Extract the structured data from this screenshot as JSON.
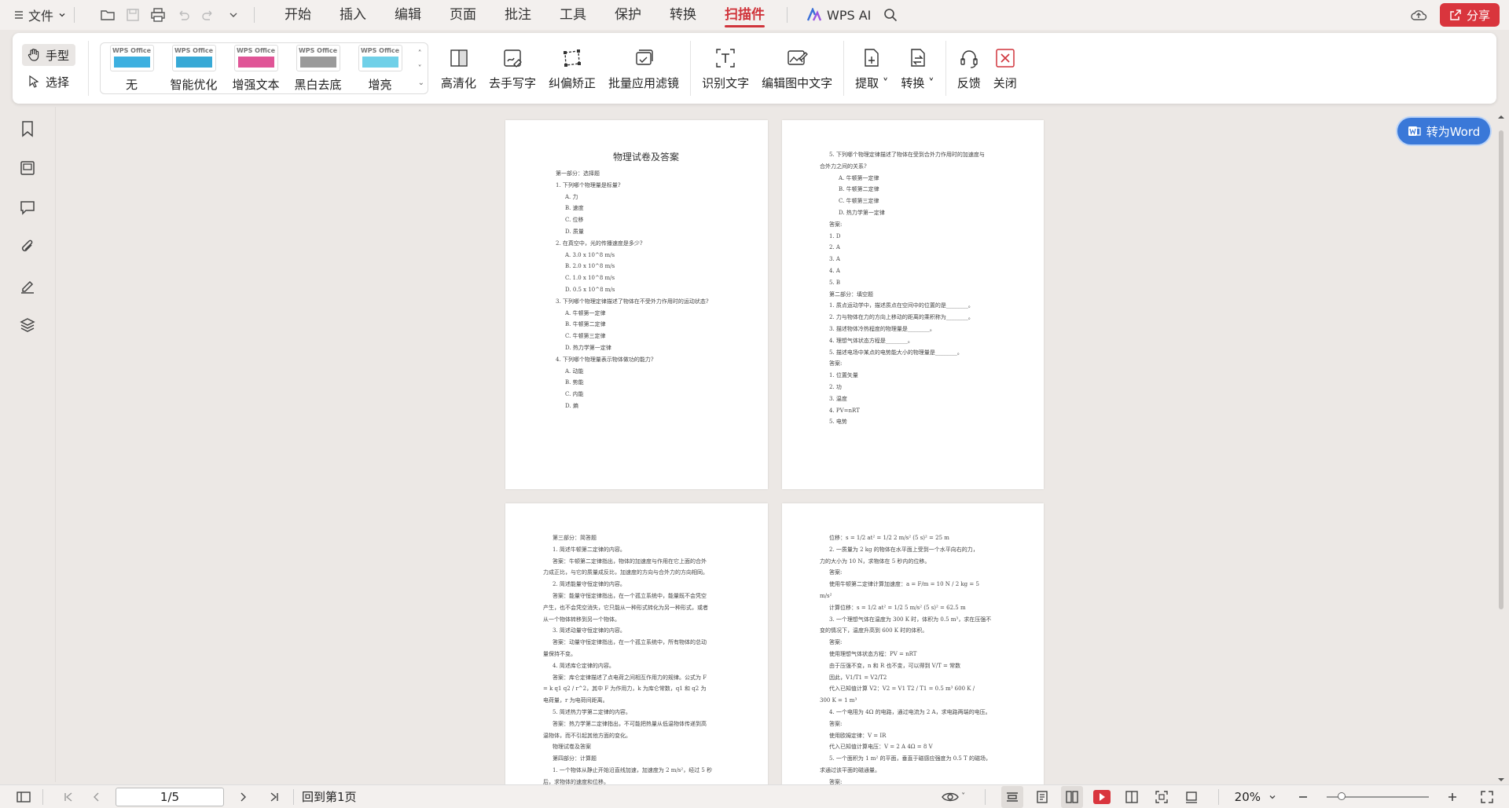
{
  "menubar": {
    "file_label": "文件",
    "tabs": [
      "开始",
      "插入",
      "编辑",
      "页面",
      "批注",
      "工具",
      "保护",
      "转换",
      "扫描件"
    ],
    "active_tab": "扫描件",
    "wps_ai": "WPS AI",
    "share": "分享"
  },
  "ribbon": {
    "modes": [
      {
        "label": "手型",
        "icon": "hand-icon"
      },
      {
        "label": "选择",
        "icon": "cursor-icon"
      }
    ],
    "filters": [
      {
        "label": "无",
        "logo": "WPS Office",
        "color": "#3db0e0"
      },
      {
        "label": "智能优化",
        "logo": "WPS Office",
        "color": "#37a9d6"
      },
      {
        "label": "增强文本",
        "logo": "WPS Office",
        "color": "#e05597"
      },
      {
        "label": "黑白去底",
        "logo": "WPS Office",
        "color": "#9a9a9a"
      },
      {
        "label": "增亮",
        "logo": "WPS Office",
        "color": "#6fd0e8"
      }
    ],
    "tools": [
      "高清化",
      "去手写字",
      "纠偏矫正",
      "批量应用滤镜"
    ],
    "ocr": [
      "识别文字",
      "编辑图中文字"
    ],
    "extract": "提取",
    "convert": "转换",
    "feedback": "反馈",
    "close": "关闭"
  },
  "convert_word": "转为Word",
  "pages": {
    "p1": {
      "title": "物理试卷及答案",
      "lines": [
        {
          "t": "第一部分：选择题",
          "i": 0
        },
        {
          "t": "1. 下列哪个物理量是标量?",
          "i": 0
        },
        {
          "t": "A. 力",
          "i": 1
        },
        {
          "t": "B. 速度",
          "i": 1
        },
        {
          "t": "C. 位移",
          "i": 1
        },
        {
          "t": "D. 质量",
          "i": 1
        },
        {
          "t": "2. 在真空中，光的传播速度是多少?",
          "i": 0
        },
        {
          "t": "A. 3.0 x 10^8 m/s",
          "i": 1
        },
        {
          "t": "B. 2.0 x 10^8 m/s",
          "i": 1
        },
        {
          "t": "C. 1.0 x 10^8 m/s",
          "i": 1
        },
        {
          "t": "D. 0.5 x 10^8 m/s",
          "i": 1
        },
        {
          "t": "3. 下列哪个物理定律描述了物体在不受外力作用时的运动状态?",
          "i": 0
        },
        {
          "t": "A. 牛顿第一定律",
          "i": 1
        },
        {
          "t": "B. 牛顿第二定律",
          "i": 1
        },
        {
          "t": "C. 牛顿第三定律",
          "i": 1
        },
        {
          "t": "D. 热力学第一定律",
          "i": 1
        },
        {
          "t": "4. 下列哪个物理量表示物体做功的能力?",
          "i": 0
        },
        {
          "t": "A. 动能",
          "i": 1
        },
        {
          "t": "B. 势能",
          "i": 1
        },
        {
          "t": "C. 内能",
          "i": 1
        },
        {
          "t": "D. 熵",
          "i": 1
        }
      ]
    },
    "p2": {
      "lines": [
        {
          "t": "5. 下列哪个物理定律描述了物体在受到合外力作用时的加速度与",
          "i": 1
        },
        {
          "t": "合外力之间的关系?",
          "i": 0
        },
        {
          "t": "A. 牛顿第一定律",
          "i": 2
        },
        {
          "t": "B. 牛顿第二定律",
          "i": 2
        },
        {
          "t": "C. 牛顿第三定律",
          "i": 2
        },
        {
          "t": "D. 热力学第一定律",
          "i": 2
        },
        {
          "t": "答案:",
          "i": 1
        },
        {
          "t": "1. D",
          "i": 1
        },
        {
          "t": "2. A",
          "i": 1
        },
        {
          "t": "3. A",
          "i": 1
        },
        {
          "t": "4. A",
          "i": 1
        },
        {
          "t": "5. B",
          "i": 1
        },
        {
          "t": "第二部分：填空题",
          "i": 1
        },
        {
          "t": "1. 质点运动学中，描述质点在空间中的位置的是________。",
          "i": 1
        },
        {
          "t": "2. 力与物体在力的方向上移动的距离的乘积称为________。",
          "i": 1
        },
        {
          "t": "3. 描述物体冷热程度的物理量是________。",
          "i": 1
        },
        {
          "t": "4. 理想气体状态方程是________。",
          "i": 1
        },
        {
          "t": "5. 描述电场中某点的电势能大小的物理量是________。",
          "i": 1
        },
        {
          "t": "答案:",
          "i": 1
        },
        {
          "t": "1. 位置矢量",
          "i": 1
        },
        {
          "t": "2. 功",
          "i": 1
        },
        {
          "t": "3. 温度",
          "i": 1
        },
        {
          "t": "4. PV=nRT",
          "i": 1
        },
        {
          "t": "5. 电势",
          "i": 1
        }
      ]
    },
    "p3": {
      "lines": [
        {
          "t": "第三部分：简答题",
          "i": 1
        },
        {
          "t": "1. 简述牛顿第二定律的内容。",
          "i": 1
        },
        {
          "t": "答案：牛顿第二定律指出，物体的加速度与作用在它上面的合外",
          "i": 1
        },
        {
          "t": "力成正比，与它的质量成反比，加速度的方向与合外力的方向相同。",
          "i": 0
        },
        {
          "t": "2. 简述能量守恒定律的内容。",
          "i": 1
        },
        {
          "t": "答案：能量守恒定律指出，在一个孤立系统中，能量既不会凭空",
          "i": 1
        },
        {
          "t": "产生，也不会凭空消失，它只能从一种形式转化为另一种形式，或者",
          "i": 0
        },
        {
          "t": "从一个物体转移到另一个物体。",
          "i": 0
        },
        {
          "t": "3. 简述动量守恒定律的内容。",
          "i": 1
        },
        {
          "t": "答案：动量守恒定律指出，在一个孤立系统中，所有物体的总动",
          "i": 1
        },
        {
          "t": "量保持不变。",
          "i": 0
        },
        {
          "t": "4. 简述库仑定律的内容。",
          "i": 1
        },
        {
          "t": "答案：库仑定律描述了点电荷之间相互作用力的规律。公式为 F",
          "i": 1
        },
        {
          "t": "= k  q1  q2 / r^2，其中 F 为作用力，k 为库仑常数，q1 和 q2 为",
          "i": 0
        },
        {
          "t": "电荷量，r 为电荷间距离。",
          "i": 0
        },
        {
          "t": "5. 简述热力学第二定律的内容。",
          "i": 1
        },
        {
          "t": "答案：热力学第二定律指出，不可能把热量从低温物体传递到高",
          "i": 1
        },
        {
          "t": "温物体，而不引起其他方面的变化。",
          "i": 0
        },
        {
          "t": "物理试卷及答案",
          "i": 1
        },
        {
          "t": "第四部分：计算题",
          "i": 1
        },
        {
          "t": "1. 一个物体从静止开始沿直线加速，加速度为 2 m/s²，经过 5 秒",
          "i": 1
        },
        {
          "t": "后，求物体的速度和位移。",
          "i": 0
        }
      ]
    },
    "p4": {
      "lines": [
        {
          "t": "位移：s = 1/2  at² = 1/2  2 m/s²  (5 s)² = 25 m",
          "i": 1
        },
        {
          "t": "2. 一质量为 2 kg 的物体在水平面上受到一个水平向右的力，",
          "i": 1
        },
        {
          "t": "力的大小为 10 N，求物体在 5 秒内的位移。",
          "i": 0
        },
        {
          "t": "答案:",
          "i": 1
        },
        {
          "t": "使用牛顿第二定律计算加速度：a = F/m = 10 N / 2 kg = 5",
          "i": 1
        },
        {
          "t": "m/s²",
          "i": 0
        },
        {
          "t": "计算位移：s = 1/2  at² = 1/2  5 m/s²  (5 s)² = 62.5 m",
          "i": 1
        },
        {
          "t": "3. 一个理想气体在温度为 300 K 时，体积为 0.5 m³，求在压强不",
          "i": 1
        },
        {
          "t": "变的情况下，温度升高到 600 K 时的体积。",
          "i": 0
        },
        {
          "t": "答案:",
          "i": 1
        },
        {
          "t": "使用理想气体状态方程：PV = nRT",
          "i": 1
        },
        {
          "t": "由于压强不变，n 和 R 也不变，可以得到 V/T = 常数",
          "i": 1
        },
        {
          "t": "因此，V1/T1 = V2/T2",
          "i": 1
        },
        {
          "t": "代入已知值计算 V2：V2 = V1  T2 / T1 = 0.5 m³  600 K /",
          "i": 1
        },
        {
          "t": "300 K = 1 m³",
          "i": 0
        },
        {
          "t": "4. 一个电阻为 4Ω 的电路，通过电流为 2 A，求电路两端的电压。",
          "i": 1
        },
        {
          "t": "答案:",
          "i": 1
        },
        {
          "t": "使用欧姆定律：V = IR",
          "i": 1
        },
        {
          "t": "代入已知值计算电压：V = 2 A  4Ω = 8 V",
          "i": 1
        },
        {
          "t": "5. 一个面积为 1 m² 的平面，垂直于磁感应强度为 0.5 T 的磁场，",
          "i": 1
        },
        {
          "t": "求通过该平面的磁通量。",
          "i": 0
        },
        {
          "t": "答案:",
          "i": 1
        }
      ]
    }
  },
  "status": {
    "page_value": "1/5",
    "back_to_first": "回到第1页",
    "zoom": "20%"
  }
}
